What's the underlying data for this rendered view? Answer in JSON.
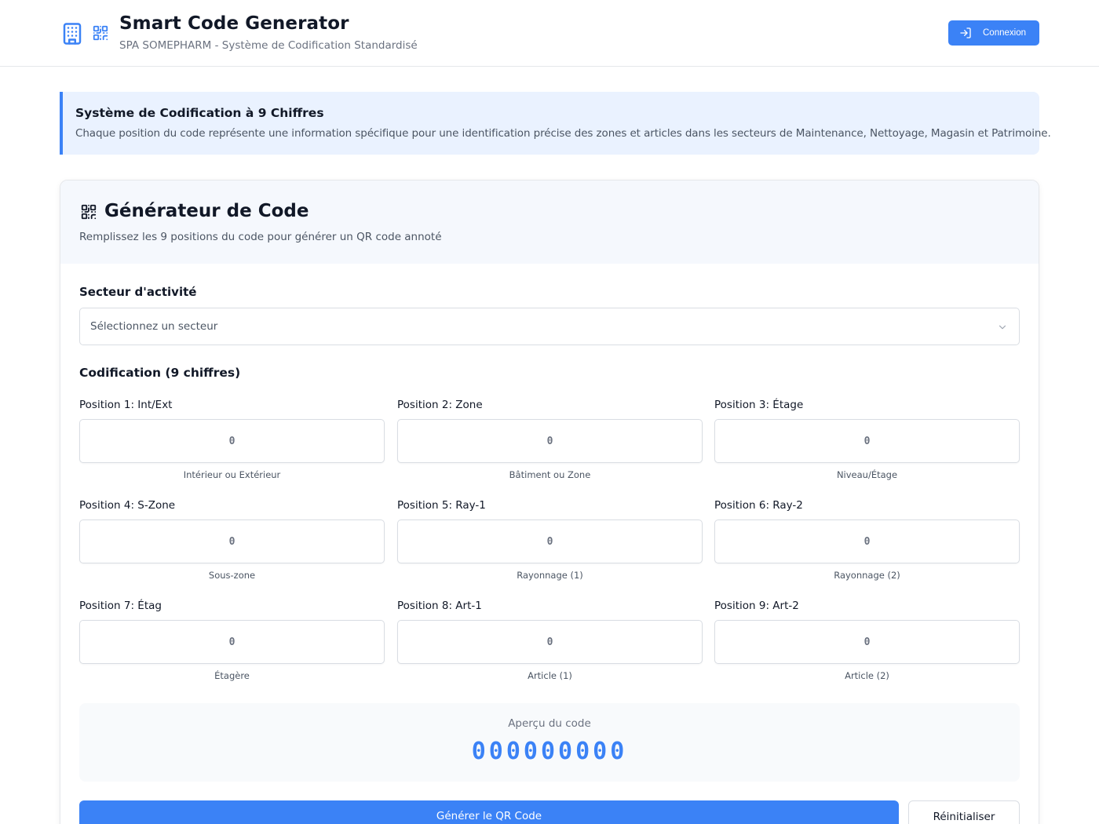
{
  "header": {
    "title": "Smart Code Generator",
    "subtitle": "SPA SOMEPHARM - Système de Codification Standardisé",
    "login_label": "Connexion"
  },
  "info": {
    "title": "Système de Codification à 9 Chiffres",
    "text": "Chaque position du code représente une information spécifique pour une identification précise des zones et articles dans les secteurs de Maintenance, Nettoyage, Magasin et Patrimoine."
  },
  "generator": {
    "title": "Générateur de Code",
    "description": "Remplissez les 9 positions du code pour générer un QR code annoté",
    "sector_label": "Secteur d'activité",
    "sector_placeholder": "Sélectionnez un secteur",
    "codification_label": "Codification (9 chiffres)",
    "positions": [
      {
        "label": "Position 1: Int/Ext",
        "placeholder": "0",
        "help": "Intérieur ou Extérieur"
      },
      {
        "label": "Position 2: Zone",
        "placeholder": "0",
        "help": "Bâtiment ou Zone"
      },
      {
        "label": "Position 3: Étage",
        "placeholder": "0",
        "help": "Niveau/Étage"
      },
      {
        "label": "Position 4: S-Zone",
        "placeholder": "0",
        "help": "Sous-zone"
      },
      {
        "label": "Position 5: Ray-1",
        "placeholder": "0",
        "help": "Rayonnage (1)"
      },
      {
        "label": "Position 6: Ray-2",
        "placeholder": "0",
        "help": "Rayonnage (2)"
      },
      {
        "label": "Position 7: Étag",
        "placeholder": "0",
        "help": "Étagère"
      },
      {
        "label": "Position 8: Art-1",
        "placeholder": "0",
        "help": "Article (1)"
      },
      {
        "label": "Position 9: Art-2",
        "placeholder": "0",
        "help": "Article (2)"
      }
    ],
    "preview_label": "Aperçu du code",
    "preview_code": "000000000",
    "generate_label": "Générer le QR Code",
    "reset_label": "Réinitialiser"
  },
  "colors": {
    "accent": "#3b82f6",
    "banner_bg": "#eaf2ff"
  },
  "icons": {
    "logo": "building-icon",
    "qr": "qr-code-icon",
    "login": "log-in-icon",
    "select": "chevron-down-icon"
  }
}
